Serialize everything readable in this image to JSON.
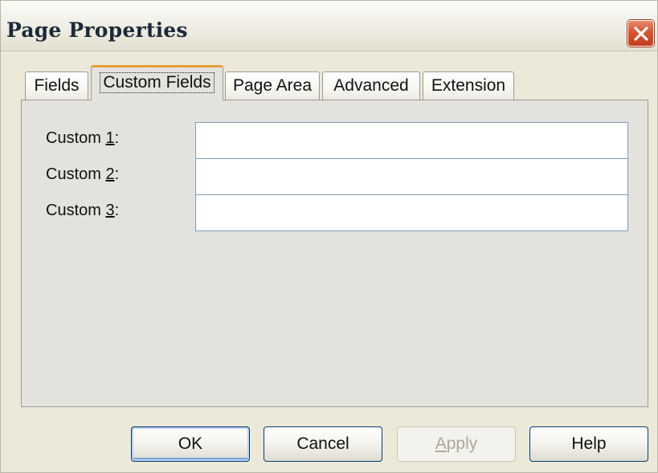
{
  "window": {
    "title": "Page Properties"
  },
  "tabs": [
    {
      "label": "Fields",
      "active": false
    },
    {
      "label": "Custom Fields",
      "active": true
    },
    {
      "label": "Page Area",
      "active": false
    },
    {
      "label": "Advanced",
      "active": false
    },
    {
      "label": "Extension",
      "active": false
    }
  ],
  "custom_fields": [
    {
      "label_prefix": "Custom ",
      "mnemonic": "1",
      "label_suffix": ":",
      "value": ""
    },
    {
      "label_prefix": "Custom ",
      "mnemonic": "2",
      "label_suffix": ":",
      "value": ""
    },
    {
      "label_prefix": "Custom ",
      "mnemonic": "3",
      "label_suffix": ":",
      "value": ""
    }
  ],
  "buttons": {
    "ok": {
      "label": "OK",
      "enabled": true,
      "default": true
    },
    "cancel": {
      "label": "Cancel",
      "enabled": true
    },
    "apply": {
      "label_mnemonic": "A",
      "label_rest": "pply",
      "enabled": false
    },
    "help": {
      "label": "Help",
      "enabled": true
    }
  },
  "icons": {
    "close": "close-icon"
  },
  "colors": {
    "dialog_bg": "#ece9d8",
    "active_tab_accent": "#e5a037",
    "close_button": "#d8542f",
    "button_border": "#003c74"
  }
}
